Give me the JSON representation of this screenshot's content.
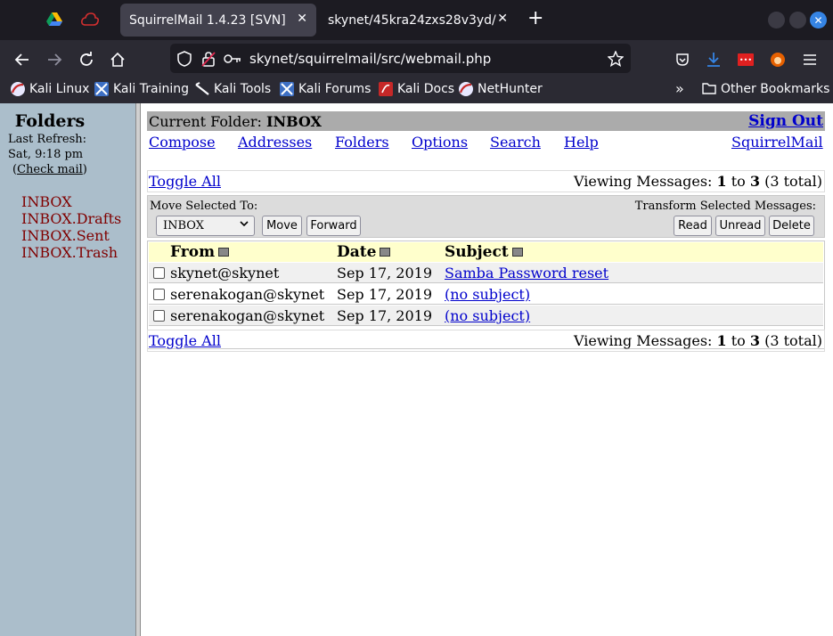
{
  "browser": {
    "tabs": [
      {
        "label": "SquirrelMail 1.4.23 [SVN]",
        "active": true
      },
      {
        "label": "skynet/45kra24zxs28v3yd/",
        "active": false
      }
    ],
    "new_tab_symbol": "+",
    "close_symbol": "✕",
    "url": "skynet/squirrelmail/src/webmail.php",
    "bookmarks": [
      {
        "label": "Kali Linux",
        "icon": "kali-dragon-icon"
      },
      {
        "label": "Kali Training",
        "icon": "kali-training-icon"
      },
      {
        "label": "Kali Tools",
        "icon": "kali-tools-icon"
      },
      {
        "label": "Kali Forums",
        "icon": "kali-forums-icon"
      },
      {
        "label": "Kali Docs",
        "icon": "kali-docs-icon"
      },
      {
        "label": "NetHunter",
        "icon": "nethunter-icon"
      }
    ],
    "overflow_symbol": "»",
    "other_bookmarks": "Other Bookmarks",
    "colors": {
      "toolbar": "#2b2a33",
      "tabstrip": "#1c1b22",
      "accent": "#3584e4"
    }
  },
  "sidebar": {
    "title": "Folders",
    "refresh_line1": "Last  Refresh:",
    "refresh_line2": "Sat,  9:18  pm",
    "check_mail_open": "(",
    "check_mail": "Check mail",
    "check_mail_close": ")",
    "folders": [
      "INBOX",
      "INBOX.Drafts",
      "INBOX.Sent",
      "INBOX.Trash"
    ],
    "colors": {
      "background": "#abbecb",
      "folder_link": "#800000"
    }
  },
  "main": {
    "current_folder_label": "Current Folder: ",
    "current_folder": "INBOX",
    "sign_out": "Sign Out",
    "nav": [
      "Compose",
      "Addresses",
      "Folders",
      "Options",
      "Search",
      "Help"
    ],
    "brand_link": "SquirrelMail",
    "toggle_all": "Toggle All",
    "viewing_prefix": "Viewing Messages: ",
    "viewing_from": "1",
    "viewing_to_word": " to ",
    "viewing_to": "3",
    "viewing_total": " (3 total)",
    "move_label": "Move Selected To:",
    "transform_label": "Transform Selected Messages:",
    "move_select_value": "INBOX",
    "buttons": {
      "move": "Move",
      "forward": "Forward",
      "read": "Read",
      "unread": "Unread",
      "delete": "Delete"
    },
    "columns": {
      "from": "From",
      "date": "Date",
      "subject": "Subject"
    },
    "messages": [
      {
        "from": "skynet@skynet",
        "date": "Sep 17, 2019",
        "subject": "Samba Password reset"
      },
      {
        "from": "serenakogan@skynet",
        "date": "Sep 17, 2019",
        "subject": "(no subject)"
      },
      {
        "from": "serenakogan@skynet",
        "date": "Sep 17, 2019",
        "subject": "(no subject)"
      }
    ],
    "colors": {
      "link": "#0000cc",
      "header_row": "#ffffcc",
      "folder_bar": "#ababab"
    }
  }
}
